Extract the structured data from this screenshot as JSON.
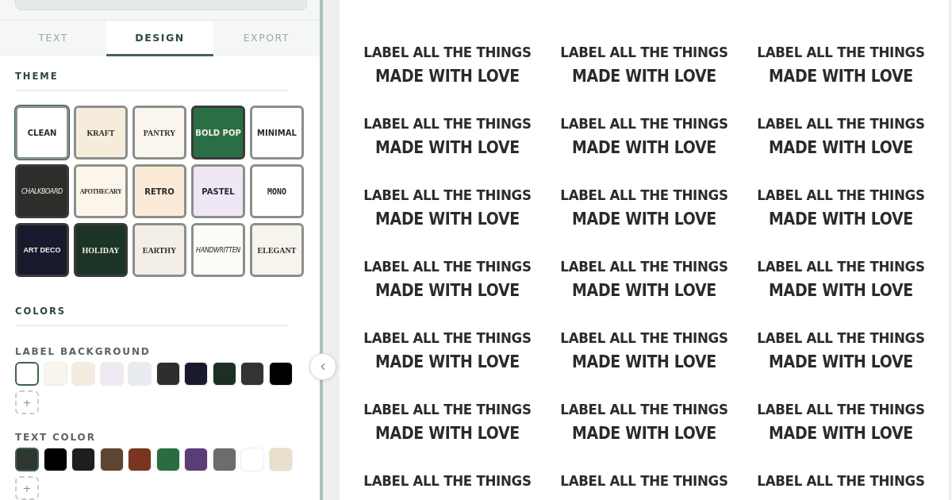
{
  "tabs": [
    {
      "label": "TEXT",
      "selected": false
    },
    {
      "label": "DESIGN",
      "selected": true
    },
    {
      "label": "EXPORT",
      "selected": false
    }
  ],
  "theme": {
    "title": "THEME",
    "tiles": [
      {
        "name": "CLEAN",
        "kind": "sans",
        "color": "#ffffff",
        "selected": true
      },
      {
        "name": "KRAFT",
        "kind": "serif",
        "color": "#f5ecdc",
        "selected": false
      },
      {
        "name": "PANTRY",
        "kind": "serif",
        "color": "#faf6ef",
        "selected": false
      },
      {
        "name": "BOLD POP",
        "kind": "sans",
        "color": "#2a6e45",
        "selected": false
      },
      {
        "name": "MINIMAL",
        "kind": "sans",
        "color": "#ffffff",
        "selected": false
      },
      {
        "name": "CHALKBOARD",
        "kind": "script",
        "color": "#2b2e2b",
        "selected": false
      },
      {
        "name": "APOTHECARY",
        "kind": "serif",
        "color": "#fbf5ea",
        "selected": false
      },
      {
        "name": "RETRO",
        "kind": "sans",
        "color": "#fbebd6",
        "selected": false
      },
      {
        "name": "PASTEL",
        "kind": "sans",
        "color": "#efe6f6",
        "selected": false
      },
      {
        "name": "MONO",
        "kind": "mono",
        "color": "#ffffff",
        "selected": false
      },
      {
        "name": "ART DECO",
        "kind": "display",
        "color": "#1a1a2e",
        "selected": false
      },
      {
        "name": "HOLIDAY",
        "kind": "serif",
        "color": "#1d3526",
        "selected": false
      },
      {
        "name": "EARTHY",
        "kind": "serif",
        "color": "#f3efe8",
        "selected": false
      },
      {
        "name": "HANDWRITTEN",
        "kind": "script",
        "color": "#fdfdf7",
        "selected": false
      },
      {
        "name": "ELEGANT",
        "kind": "serif",
        "color": "#f7f4ee",
        "selected": false
      }
    ]
  },
  "colors": {
    "title": "COLORS",
    "groups": [
      {
        "label": "LABEL BACKGROUND",
        "add": "+",
        "swatches": [
          {
            "color": "#ffffff",
            "selected": true
          },
          {
            "color": "#f8f4ee",
            "selected": false
          },
          {
            "color": "#f3ede0",
            "selected": false
          },
          {
            "color": "#efe9f4",
            "selected": false
          },
          {
            "color": "#e8ecf1",
            "selected": false
          },
          {
            "color": "#2e2e2e",
            "selected": false
          },
          {
            "color": "#1a1a2e",
            "selected": false
          },
          {
            "color": "#1b3022",
            "selected": false
          },
          {
            "color": "#333333",
            "selected": false
          },
          {
            "color": "#000000",
            "selected": false
          }
        ]
      },
      {
        "label": "TEXT COLOR",
        "add": "+",
        "swatches": [
          {
            "color": "#2f3530",
            "selected": true
          },
          {
            "color": "#000000",
            "selected": false
          },
          {
            "color": "#1e1e1e",
            "selected": false
          },
          {
            "color": "#5c4630",
            "selected": false
          },
          {
            "color": "#7a3420",
            "selected": false
          },
          {
            "color": "#2a6e40",
            "selected": false
          },
          {
            "color": "#5a3e78",
            "selected": false
          },
          {
            "color": "#6c6c6c",
            "selected": false
          },
          {
            "color": "#ffffff",
            "selected": false
          },
          {
            "color": "#e8e0cc",
            "selected": false
          }
        ]
      }
    ]
  },
  "sheet": {
    "labels": [
      {
        "lines": [
          "LABEL ALL THE THINGS",
          "MADE WITH LOVE"
        ]
      },
      {
        "lines": [
          "LABEL ALL THE THINGS",
          "MADE WITH LOVE"
        ]
      },
      {
        "lines": [
          "LABEL ALL THE THINGS",
          "MADE WITH LOVE"
        ]
      },
      {
        "lines": [
          "LABEL ALL THE THINGS",
          "MADE WITH LOVE"
        ]
      },
      {
        "lines": [
          "LABEL ALL THE THINGS",
          "MADE WITH LOVE"
        ]
      },
      {
        "lines": [
          "LABEL ALL THE THINGS",
          "MADE WITH LOVE"
        ]
      },
      {
        "lines": [
          "LABEL ALL THE THINGS",
          "MADE WITH LOVE"
        ]
      },
      {
        "lines": [
          "LABEL ALL THE THINGS",
          "MADE WITH LOVE"
        ]
      },
      {
        "lines": [
          "LABEL ALL THE THINGS",
          "MADE WITH LOVE"
        ]
      },
      {
        "lines": [
          "LABEL ALL THE THINGS",
          "MADE WITH LOVE"
        ]
      },
      {
        "lines": [
          "LABEL ALL THE THINGS",
          "MADE WITH LOVE"
        ]
      },
      {
        "lines": [
          "LABEL ALL THE THINGS",
          "MADE WITH LOVE"
        ]
      },
      {
        "lines": [
          "LABEL ALL THE THINGS",
          "MADE WITH LOVE"
        ]
      },
      {
        "lines": [
          "LABEL ALL THE THINGS",
          "MADE WITH LOVE"
        ]
      },
      {
        "lines": [
          "LABEL ALL THE THINGS",
          "MADE WITH LOVE"
        ]
      },
      {
        "lines": [
          "LABEL ALL THE THINGS",
          "MADE WITH LOVE"
        ]
      },
      {
        "lines": [
          "LABEL ALL THE THINGS",
          "MADE WITH LOVE"
        ]
      },
      {
        "lines": [
          "LABEL ALL THE THINGS",
          "MADE WITH LOVE"
        ]
      },
      {
        "lines": [
          "LABEL ALL THE THINGS"
        ]
      },
      {
        "lines": [
          "LABEL ALL THE THINGS"
        ]
      },
      {
        "lines": [
          "LABEL ALL THE THINGS"
        ]
      }
    ]
  }
}
